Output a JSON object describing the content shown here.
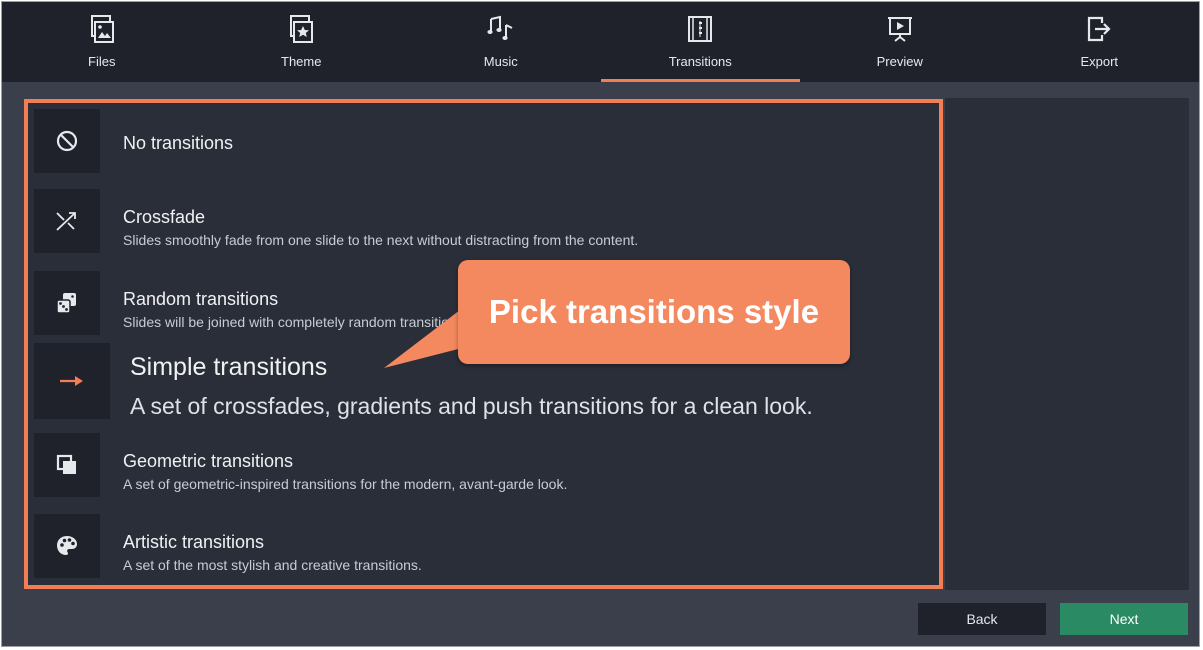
{
  "tabs": [
    {
      "label": "Files",
      "icon": "files-icon"
    },
    {
      "label": "Theme",
      "icon": "theme-icon"
    },
    {
      "label": "Music",
      "icon": "music-icon"
    },
    {
      "label": "Transitions",
      "icon": "transitions-icon",
      "active": true
    },
    {
      "label": "Preview",
      "icon": "preview-icon"
    },
    {
      "label": "Export",
      "icon": "export-icon"
    }
  ],
  "transitions": [
    {
      "title": "No transitions",
      "description": "",
      "icon": "no-symbol-icon"
    },
    {
      "title": "Crossfade",
      "description": "Slides smoothly fade from one slide to the next without distracting from the content.",
      "icon": "shuffle-icon"
    },
    {
      "title": "Random transitions",
      "description": "Slides will be joined with completely random transitions.",
      "icon": "dice-icon"
    },
    {
      "title": "Simple transitions",
      "description": "A set of crossfades, gradients and push transitions for a clean look.",
      "icon": "arrow-right-icon",
      "highlighted": true
    },
    {
      "title": "Geometric transitions",
      "description": "A set of geometric-inspired transitions for the modern, avant-garde look.",
      "icon": "squares-icon"
    },
    {
      "title": "Artistic transitions",
      "description": "A set of the most stylish and creative transitions.",
      "icon": "palette-icon"
    }
  ],
  "callout": {
    "text": "Pick transitions style"
  },
  "buttons": {
    "back": "Back",
    "next": "Next"
  },
  "colors": {
    "accent": "#f37d54",
    "next_button": "#2a8a64",
    "background": "#3b3f4b",
    "panel": "#2a2e38",
    "topbar": "#1f222b"
  }
}
